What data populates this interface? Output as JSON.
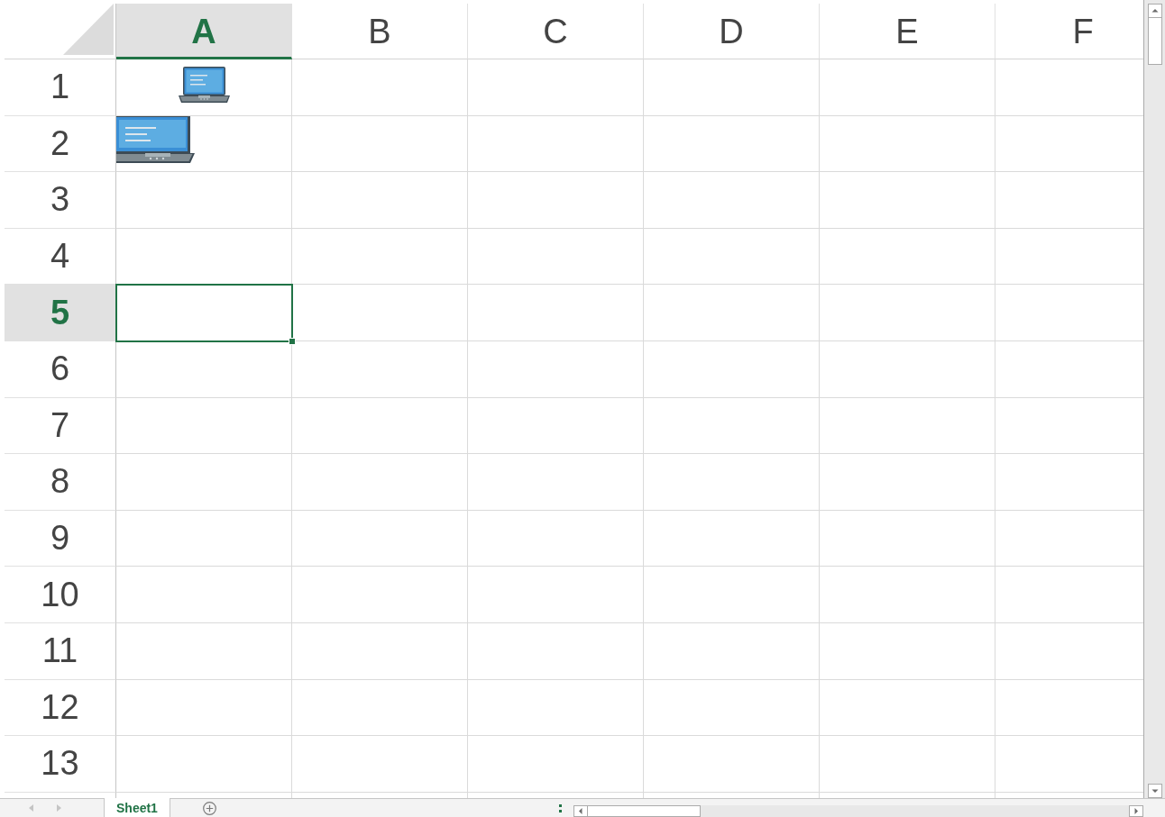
{
  "columns": [
    {
      "label": "A",
      "selected": true
    },
    {
      "label": "B",
      "selected": false
    },
    {
      "label": "C",
      "selected": false
    },
    {
      "label": "D",
      "selected": false
    },
    {
      "label": "E",
      "selected": false
    },
    {
      "label": "F",
      "selected": false
    }
  ],
  "rows": [
    {
      "label": "1",
      "selected": false
    },
    {
      "label": "2",
      "selected": false
    },
    {
      "label": "3",
      "selected": false
    },
    {
      "label": "4",
      "selected": false
    },
    {
      "label": "5",
      "selected": true
    },
    {
      "label": "6",
      "selected": false
    },
    {
      "label": "7",
      "selected": false
    },
    {
      "label": "8",
      "selected": false
    },
    {
      "label": "9",
      "selected": false
    },
    {
      "label": "10",
      "selected": false
    },
    {
      "label": "11",
      "selected": false
    },
    {
      "label": "12",
      "selected": false
    },
    {
      "label": "13",
      "selected": false
    }
  ],
  "sheet_tabs": [
    {
      "label": "Sheet1",
      "selected": true
    }
  ]
}
